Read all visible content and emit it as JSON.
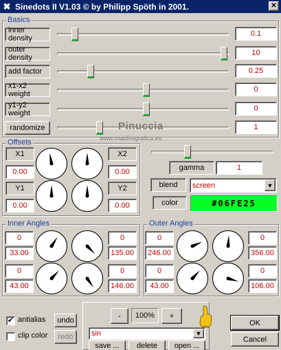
{
  "window": {
    "title": "Sinedots II V1.03 © by Philipp Spöth in 2001.",
    "close_glyph": "✕",
    "app_icon": "✖"
  },
  "watermark": {
    "name": "Pinuccia",
    "url": "www.maidiregrafica.eu"
  },
  "basics": {
    "label": "Basics",
    "rows": [
      {
        "label": "inner density",
        "value": "0.1",
        "slider": 0.04
      },
      {
        "label": "outer density",
        "value": "10",
        "slider": 1.0
      },
      {
        "label": "add factor",
        "value": "0.25",
        "slider": 0.14
      },
      {
        "label": "x1-x2 weight",
        "value": "0",
        "slider": 0.5
      },
      {
        "label": "y1-y2 weight",
        "value": "0",
        "slider": 0.5
      },
      {
        "label": "randomize",
        "value": "1",
        "slider": 0.2
      }
    ]
  },
  "offsets": {
    "label": "Offsets",
    "x1": {
      "label": "X1",
      "value": "0.00"
    },
    "x2": {
      "label": "X2",
      "value": "0.00"
    },
    "y1": {
      "label": "Y1",
      "value": "0.00"
    },
    "y2": {
      "label": "Y2",
      "value": "0.00"
    },
    "dial_angles": [
      -10,
      0,
      0,
      0
    ]
  },
  "render": {
    "gamma_label": "gamma",
    "gamma_value": "1",
    "gamma_slider": 0.28,
    "blend_label": "blend",
    "blend_value": "screen",
    "color_label": "color",
    "color_value": "#06FE25",
    "color_hex": "#06fe25"
  },
  "inner_angles": {
    "label": "Inner Angles",
    "rows": [
      {
        "left": {
          "a": "0",
          "b": "33.00"
        },
        "right": {
          "a": "0",
          "b": "135.00"
        }
      },
      {
        "left": {
          "a": "0",
          "b": "43.00"
        },
        "right": {
          "a": "0",
          "b": "146.00"
        }
      }
    ],
    "dial_angles": [
      33,
      135,
      43,
      146
    ]
  },
  "outer_angles": {
    "label": "Outer Angles",
    "rows": [
      {
        "left": {
          "a": "0",
          "b": "246.00"
        },
        "right": {
          "a": "0",
          "b": "356.00"
        }
      },
      {
        "left": {
          "a": "0",
          "b": "43.00"
        },
        "right": {
          "a": "0",
          "b": "106.00"
        }
      }
    ],
    "dial_angles": [
      66,
      4,
      43,
      106
    ]
  },
  "options": {
    "antialias_label": "antialias",
    "antialias_checked": true,
    "clipcolor_label": "clip color",
    "clipcolor_checked": false,
    "undo_label": "undo",
    "redo_label": "redo"
  },
  "presets": {
    "minus_label": "-",
    "zoom_label": "100%",
    "plus_label": "+",
    "current": "sin",
    "save_label": "save ...",
    "delete_label": "delete",
    "open_label": "open ..."
  },
  "dialog": {
    "ok_label": "OK",
    "cancel_label": "Cancel"
  }
}
